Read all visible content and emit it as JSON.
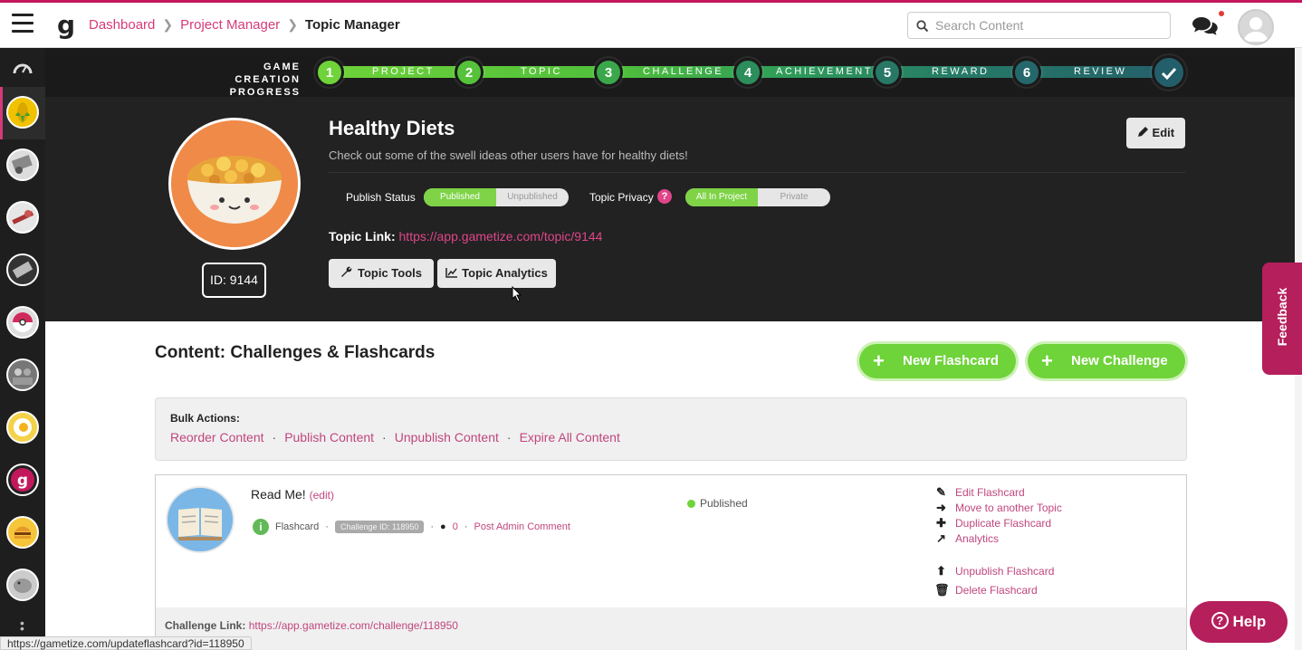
{
  "nav": {
    "logo": "g",
    "breadcrumb": [
      "Dashboard",
      "Topic Manager"
    ],
    "breadcrumb_middle": "Project Manager",
    "search_placeholder": "Search Content"
  },
  "progress": {
    "label": "GAME CREATION PROGRESS",
    "steps": [
      {
        "num": "1",
        "label": "PROJECT"
      },
      {
        "num": "2",
        "label": "TOPIC"
      },
      {
        "num": "3",
        "label": "CHALLENGE"
      },
      {
        "num": "4",
        "label": "ACHIEVEMENT"
      },
      {
        "num": "5",
        "label": "REWARD"
      },
      {
        "num": "6",
        "label": "REVIEW"
      }
    ],
    "final_icon": "checkmark-icon"
  },
  "topic": {
    "title": "Healthy Diets",
    "description": "Check out some of the swell ideas other users have for healthy diets!",
    "id_label": "ID: 9144",
    "edit_label": "Edit",
    "publish_status_label": "Publish Status",
    "publish_on": "Published",
    "publish_off": "Unpublished",
    "privacy_label": "Topic Privacy",
    "privacy_on": "All In Project",
    "privacy_off": "Private",
    "link_label": "Topic Link:",
    "link_url": "https://app.gametize.com/topic/9144",
    "tools_label": "Topic Tools",
    "analytics_label": "Topic Analytics"
  },
  "content": {
    "title": "Content: Challenges & Flashcards",
    "new_flashcard": "New Flashcard",
    "new_challenge": "New Challenge",
    "bulk_title": "Bulk Actions:",
    "bulk_actions": [
      "Reorder Content",
      "Publish Content",
      "Unpublish Content",
      "Expire All Content"
    ]
  },
  "item": {
    "name": "Read Me!",
    "edit": "(edit)",
    "type": "Flashcard",
    "challenge_id": "Challenge ID: 118950",
    "comments": "0",
    "post_comment": "Post Admin Comment",
    "status": "Published",
    "actions": [
      "Edit Flashcard",
      "Move to another Topic",
      "Duplicate Flashcard",
      "Analytics",
      "Unpublish Flashcard",
      "Delete Flashcard"
    ],
    "link_label": "Challenge Link:",
    "link_url": "https://app.gametize.com/challenge/118950"
  },
  "statusbar": "https://gametize.com/updateflashcard?id=118950",
  "feedback": "Feedback",
  "help": "Help",
  "colors": {
    "accent": "#d63a78",
    "green": "#6fd33a",
    "dark": "#222222",
    "help": "#b51f5c"
  }
}
